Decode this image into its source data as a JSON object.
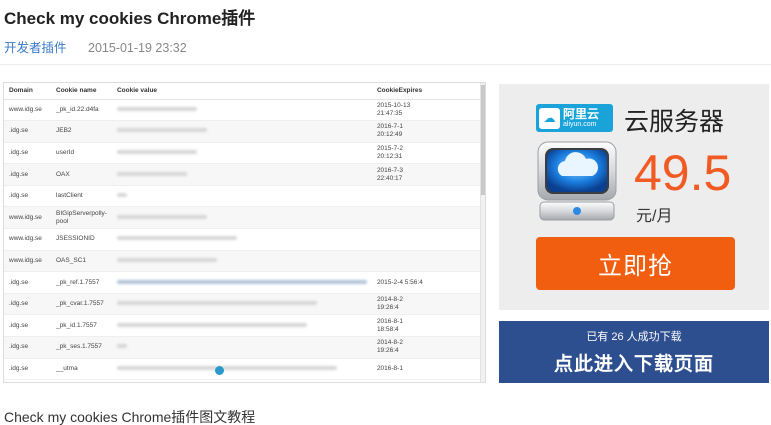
{
  "article": {
    "title": "Check my cookies Chrome插件",
    "category": "开发者插件",
    "date": "2015-01-19 23:32",
    "caption": "Check my cookies Chrome插件图文教程"
  },
  "screenshot": {
    "headers": [
      "Domain",
      "Cookie name",
      "Cookie value",
      "CookieExpires"
    ],
    "rows": [
      {
        "domain": "www.idg.se",
        "name": "_pk_id.22.d4fa",
        "expires": "2015-10-13\n21:47:35"
      },
      {
        "domain": ".idg.se",
        "name": "JEB2",
        "expires": "2016-7-1\n20:12:49"
      },
      {
        "domain": ".idg.se",
        "name": "userId",
        "expires": "2015-7-2\n20:12:31"
      },
      {
        "domain": ".idg.se",
        "name": "OAX",
        "expires": "2016-7-3\n22:40:17"
      },
      {
        "domain": ".idg.se",
        "name": "lastClient",
        "expires": ""
      },
      {
        "domain": "www.idg.se",
        "name": "BIGipServerpolly-\npool",
        "expires": ""
      },
      {
        "domain": "www.idg.se",
        "name": "JSESSIONID",
        "expires": ""
      },
      {
        "domain": "www.idg.se",
        "name": "OAS_SC1",
        "expires": ""
      },
      {
        "domain": ".idg.se",
        "name": "_pk_ref.1.7557",
        "expires": "2015-2-4 5:56:4"
      },
      {
        "domain": ".idg.se",
        "name": "_pk_cvar.1.7557",
        "expires": "2014-8-2\n19:26:4"
      },
      {
        "domain": ".idg.se",
        "name": "_pk_id.1.7557",
        "expires": "2016-8-1\n18:58:4"
      },
      {
        "domain": ".idg.se",
        "name": "_pk_ses.1.7557",
        "expires": "2014-8-2\n19:26:4"
      },
      {
        "domain": ".idg.se",
        "name": "__utma",
        "expires": "2016-8-1"
      }
    ]
  },
  "ad": {
    "logo_text": "阿里云",
    "logo_subtext": "aliyun.com",
    "product": "云服务器",
    "price": "49.5",
    "unit": "元/月",
    "buy_label": "立即抢",
    "colors": {
      "accent": "#f15a22",
      "logo": "#1aa3d8"
    }
  },
  "download": {
    "count_label": "已有 26 人成功下载",
    "go_label": "点此进入下载页面",
    "color": "#2e4f8f"
  }
}
